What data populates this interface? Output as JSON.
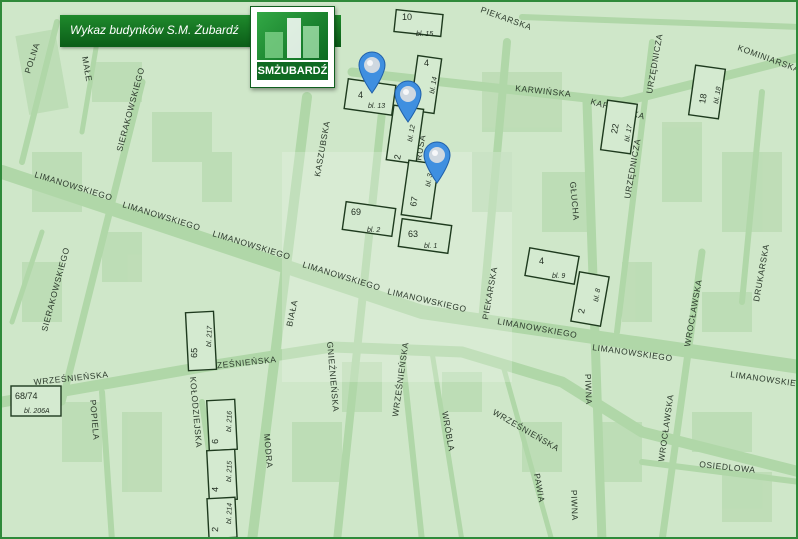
{
  "header": {
    "title": "Wykaz budynków S.M. Żubardź",
    "logo_text": "SMŻUBARDŹ"
  },
  "watermark": "ŻUBARDŹ",
  "colors": {
    "map_bg": "#cfe7c9",
    "road": "#b3d8ac",
    "building_fill": "#cfe7c9",
    "building_stroke": "#1e3a1e",
    "banner": "#137524",
    "pin": "#3f8fe0"
  },
  "streets": [
    {
      "id": "polna",
      "label": "POLNA"
    },
    {
      "id": "male",
      "label": "MAŁE"
    },
    {
      "id": "sierakowskiego1",
      "label": "SIERAKOWSKIEGO"
    },
    {
      "id": "sierakowskiego2",
      "label": "SIERAKOWSKIEGO"
    },
    {
      "id": "kaszubska",
      "label": "KASZUBSKA"
    },
    {
      "id": "piekarska1",
      "label": "PIEKARSKA"
    },
    {
      "id": "piekarska2",
      "label": "PIEKARSKA"
    },
    {
      "id": "karwinska1",
      "label": "KARWIŃSKA"
    },
    {
      "id": "karwinska2",
      "label": "KARWIŃSKA"
    },
    {
      "id": "kominiarska",
      "label": "KOMINIARSKA"
    },
    {
      "id": "urzednicza1",
      "label": "URZĘDNICZA"
    },
    {
      "id": "urzednicza2",
      "label": "URZĘDNICZA"
    },
    {
      "id": "prusa",
      "label": "PRUSA"
    },
    {
      "id": "glucha",
      "label": "GŁUCHA"
    },
    {
      "id": "limanowskiego1",
      "label": "LIMANOWSKIEGO"
    },
    {
      "id": "limanowskiego2",
      "label": "LIMANOWSKIEGO"
    },
    {
      "id": "limanowskiego3",
      "label": "LIMANOWSKIEGO"
    },
    {
      "id": "limanowskiego4",
      "label": "LIMANOWSKIEGO"
    },
    {
      "id": "limanowskiego5",
      "label": "LIMANOWSKIEGO"
    },
    {
      "id": "limanowskiego6",
      "label": "LIMANOWSKIEGO"
    },
    {
      "id": "limanowskiego7",
      "label": "LIMANOWSKIEGO"
    },
    {
      "id": "drukarska",
      "label": "DRUKARSKA"
    },
    {
      "id": "wroclawska1",
      "label": "WROCŁAWSKA"
    },
    {
      "id": "wroclawska2",
      "label": "WROCŁAWSKA"
    },
    {
      "id": "biala",
      "label": "BIAŁA"
    },
    {
      "id": "gnieznienska",
      "label": "GNIEŹNIEŃSKA"
    },
    {
      "id": "wrzesinska1",
      "label": "WRZEŚNIEŃSKA"
    },
    {
      "id": "wrzesinska2",
      "label": "WRZEŚNIEŃSKA"
    },
    {
      "id": "wrzesinska3",
      "label": "WRZEŚNIEŃSKA"
    },
    {
      "id": "wrzesinska4",
      "label": "WRZEŚNIEŃSKA"
    },
    {
      "id": "kolodziejska",
      "label": "KOŁODZIEJSKA"
    },
    {
      "id": "popiela",
      "label": "POPIELA"
    },
    {
      "id": "modra",
      "label": "MODRA"
    },
    {
      "id": "wrobla",
      "label": "WRÓBLA"
    },
    {
      "id": "pawia",
      "label": "PAWIA"
    },
    {
      "id": "piwna1",
      "label": "PIWNA"
    },
    {
      "id": "piwna2",
      "label": "PIWNA"
    },
    {
      "id": "osiedlowa",
      "label": "OSIEDLOWA"
    }
  ],
  "buildings": [
    {
      "id": "b15",
      "number": "10",
      "label": "bl. 15"
    },
    {
      "id": "b13",
      "number": "4",
      "label": "bl. 13"
    },
    {
      "id": "b14",
      "number": "4",
      "label": "bl. 14"
    },
    {
      "id": "b12",
      "number": "2",
      "label": "bl. 12"
    },
    {
      "id": "b3",
      "number": "67",
      "label": "bl. 3"
    },
    {
      "id": "b2",
      "number": "69",
      "label": "bl. 2"
    },
    {
      "id": "b1",
      "number": "63",
      "label": "bl. 1"
    },
    {
      "id": "b9",
      "number": "4",
      "label": "bl. 9"
    },
    {
      "id": "b8",
      "number": "2",
      "label": "bl. 8"
    },
    {
      "id": "b17",
      "number": "22",
      "label": "bl. 17"
    },
    {
      "id": "b18",
      "number": "18",
      "label": "bl. 18"
    },
    {
      "id": "b217",
      "number": "65",
      "label": "bl. 217"
    },
    {
      "id": "b206a",
      "number": "68/74",
      "label": "bl. 206A"
    },
    {
      "id": "b216",
      "number": "6",
      "label": "bl. 216"
    },
    {
      "id": "b215",
      "number": "4",
      "label": "bl. 215"
    },
    {
      "id": "b214",
      "number": "2",
      "label": "bl. 214"
    }
  ],
  "markers": [
    {
      "id": "marker-1"
    },
    {
      "id": "marker-2"
    },
    {
      "id": "marker-3"
    }
  ]
}
